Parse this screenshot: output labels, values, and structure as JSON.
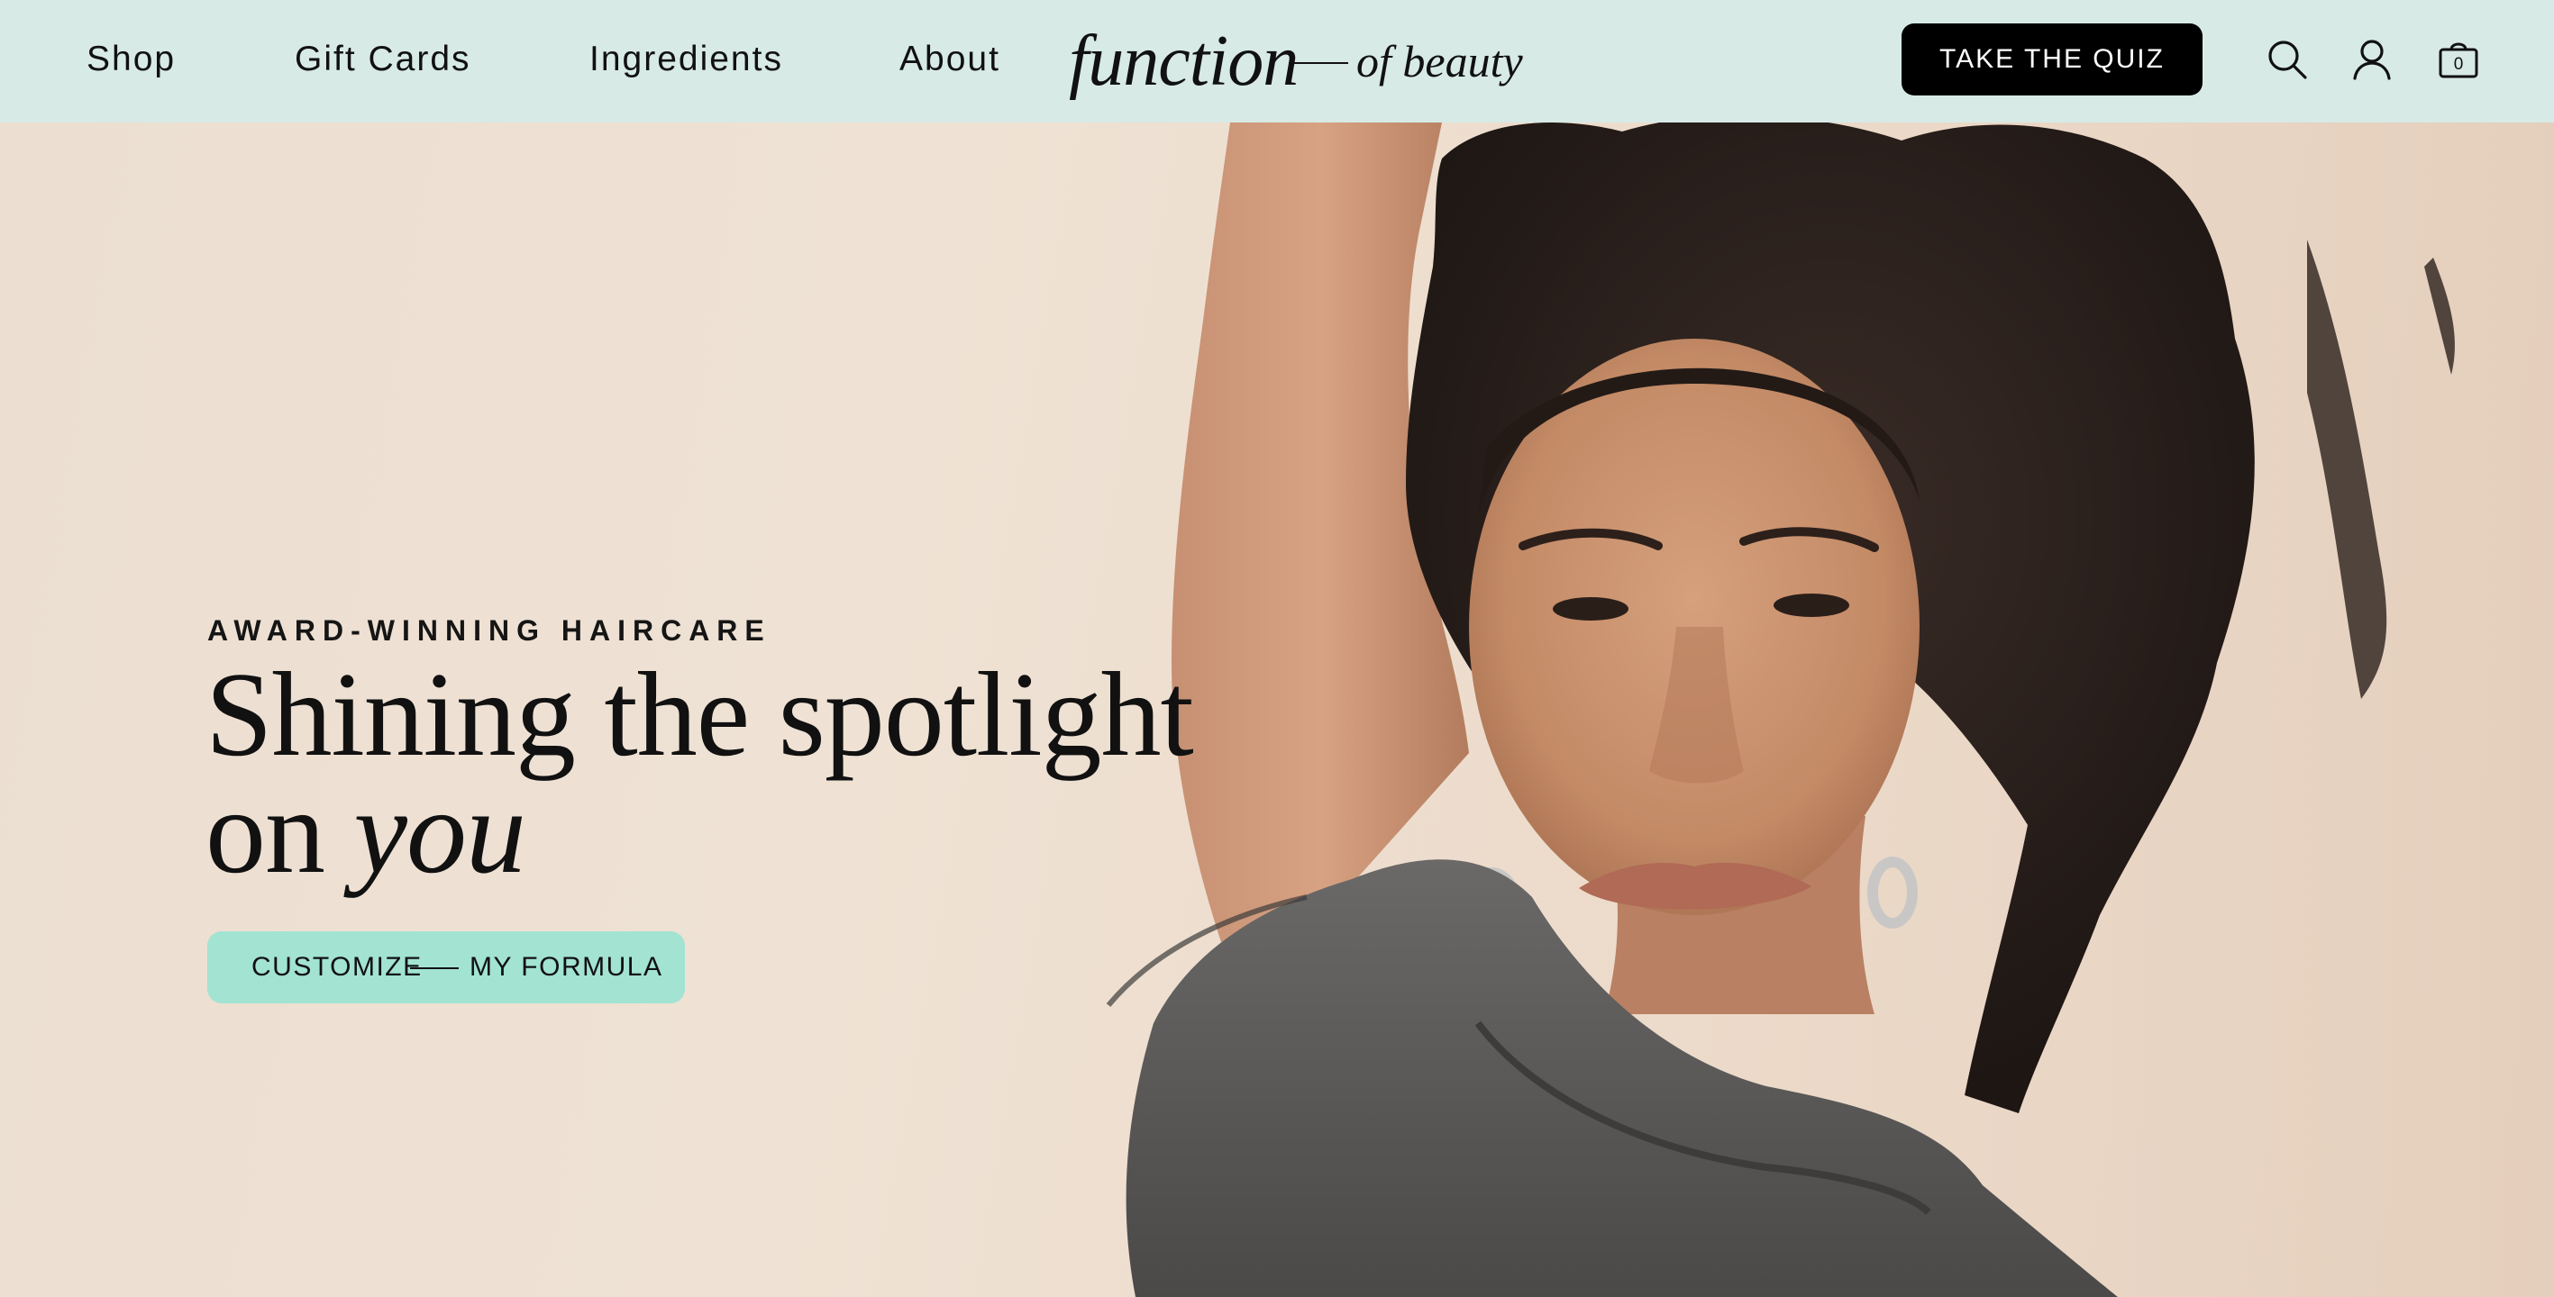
{
  "header": {
    "nav": [
      {
        "label": "Shop"
      },
      {
        "label": "Gift Cards"
      },
      {
        "label": "Ingredients"
      },
      {
        "label": "About"
      }
    ],
    "logo": {
      "main": "function",
      "sub": "of beauty"
    },
    "quiz_button": "TAKE THE QUIZ",
    "icons": {
      "search": "search-icon",
      "account": "account-icon",
      "bag": "shopping-bag-icon"
    },
    "bag_count": "0"
  },
  "hero": {
    "eyebrow": "AWARD-WINNING HAIRCARE",
    "headline_line1": "Shining the spotlight",
    "headline_line2_prefix": "on",
    "headline_line2_emphasis": "you",
    "cta_left": "CUSTOMIZE",
    "cta_right": "MY FORMULA",
    "photo": "woman-with-raised-arm-portrait"
  },
  "colors": {
    "header_bg": "#d7eae6",
    "hero_bg": "#efe3d6",
    "cta_bg": "#a2e3d2",
    "quiz_bg": "#000000",
    "text": "#111111"
  }
}
